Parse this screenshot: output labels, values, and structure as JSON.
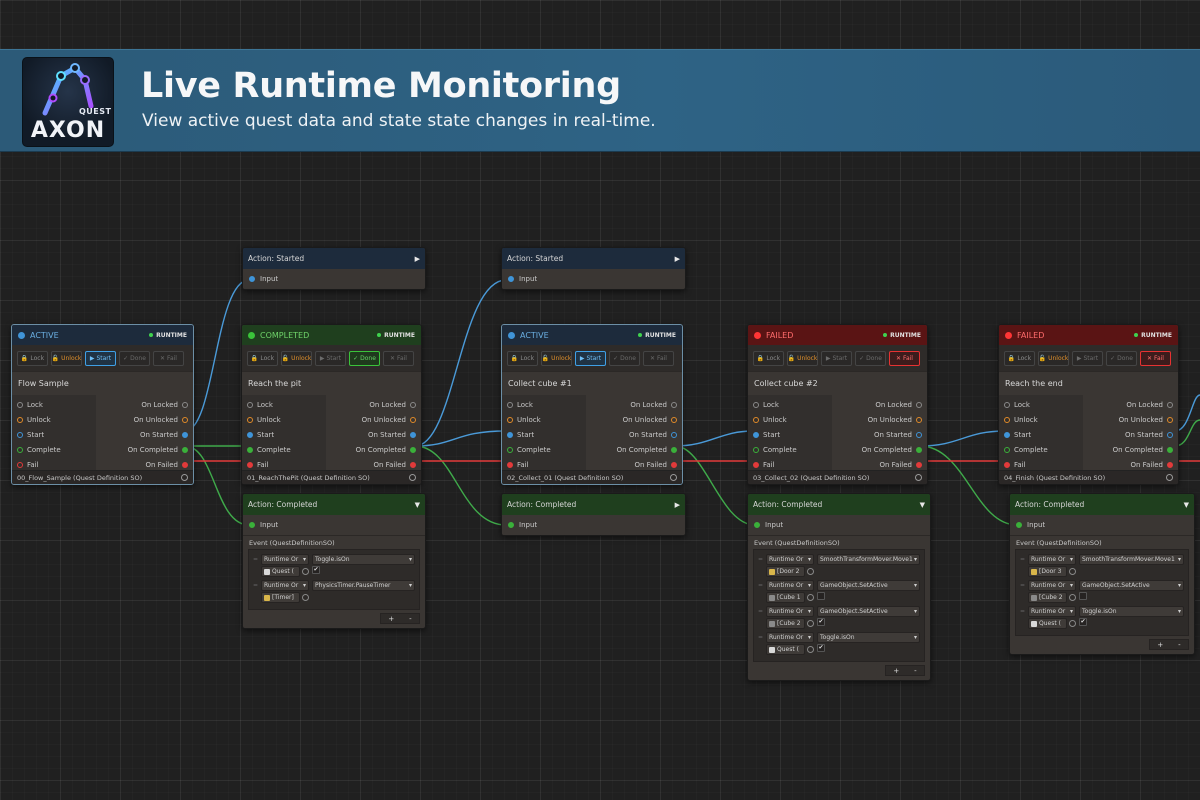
{
  "banner": {
    "title": "Live Runtime Monitoring",
    "subtitle": "View active quest data and state state changes in real-time.",
    "logo_small": "QUEST",
    "logo_big": "AXON"
  },
  "colors": {
    "active": "#3f94d8",
    "completed": "#3ac33a",
    "failed": "#ff3535",
    "banner": "#2e6385"
  },
  "common": {
    "runtime": "RUNTIME",
    "lock": "Lock",
    "unlock": "Unlock",
    "start": "Start",
    "done": "Done",
    "fail": "Fail",
    "in_lock": "Lock",
    "in_unlock": "Unlock",
    "in_start": "Start",
    "in_complete": "Complete",
    "in_fail": "Fail",
    "out_locked": "On Locked",
    "out_unlocked": "On Unlocked",
    "out_started": "On Started",
    "out_completed": "On Completed",
    "out_failed": "On Failed",
    "input": "Input",
    "event_label": "Event (QuestDefinitionSO)",
    "plus": "+",
    "minus": "-"
  },
  "nodes": {
    "q0": {
      "status": "ACTIVE",
      "name": "Flow Sample",
      "asset": "00_Flow_Sample (Quest Definition SO)"
    },
    "q1": {
      "status": "COMPLETED",
      "name": "Reach the pit",
      "asset": "01_ReachThePit (Quest Definition SO)"
    },
    "q2": {
      "status": "ACTIVE",
      "name": "Collect cube #1",
      "asset": "02_Collect_01 (Quest Definition SO)"
    },
    "q3": {
      "status": "FAILED",
      "name": "Collect cube #2",
      "asset": "03_Collect_02 (Quest Definition SO)"
    },
    "q4": {
      "status": "FAILED",
      "name": "Reach the end",
      "asset": "04_Finish (Quest Definition SO)"
    }
  },
  "actions": {
    "a1": {
      "title": "Action: Started"
    },
    "a2": {
      "title": "Action: Started"
    },
    "c1": {
      "title": "Action: Completed",
      "events": [
        {
          "mode": "Runtime Or",
          "target": "Quest (",
          "method": "Toggle.isOn",
          "arg": "✔"
        },
        {
          "mode": "Runtime Or",
          "target": "[Timer]",
          "method": "PhysicsTimer.PauseTimer",
          "arg": ""
        }
      ]
    },
    "c2": {
      "title": "Action: Completed"
    },
    "c3": {
      "title": "Action: Completed",
      "events": [
        {
          "mode": "Runtime Or",
          "target": "[Door 2",
          "method": "SmoothTransformMover.Move1",
          "arg": ""
        },
        {
          "mode": "Runtime Or",
          "target": "[Cube 1",
          "method": "GameObject.SetActive",
          "arg": ""
        },
        {
          "mode": "Runtime Or",
          "target": "[Cube 2",
          "method": "GameObject.SetActive",
          "arg": "✔"
        },
        {
          "mode": "Runtime Or",
          "target": "Quest (",
          "method": "Toggle.isOn",
          "arg": "✔"
        }
      ]
    },
    "c4": {
      "title": "Action: Completed",
      "events": [
        {
          "mode": "Runtime Or",
          "target": "[Door 3",
          "method": "SmoothTransformMover.Move1",
          "arg": ""
        },
        {
          "mode": "Runtime Or",
          "target": "[Cube 2",
          "method": "GameObject.SetActive",
          "arg": ""
        },
        {
          "mode": "Runtime Or",
          "target": "Quest (",
          "method": "Toggle.isOn",
          "arg": "✔"
        }
      ]
    }
  }
}
